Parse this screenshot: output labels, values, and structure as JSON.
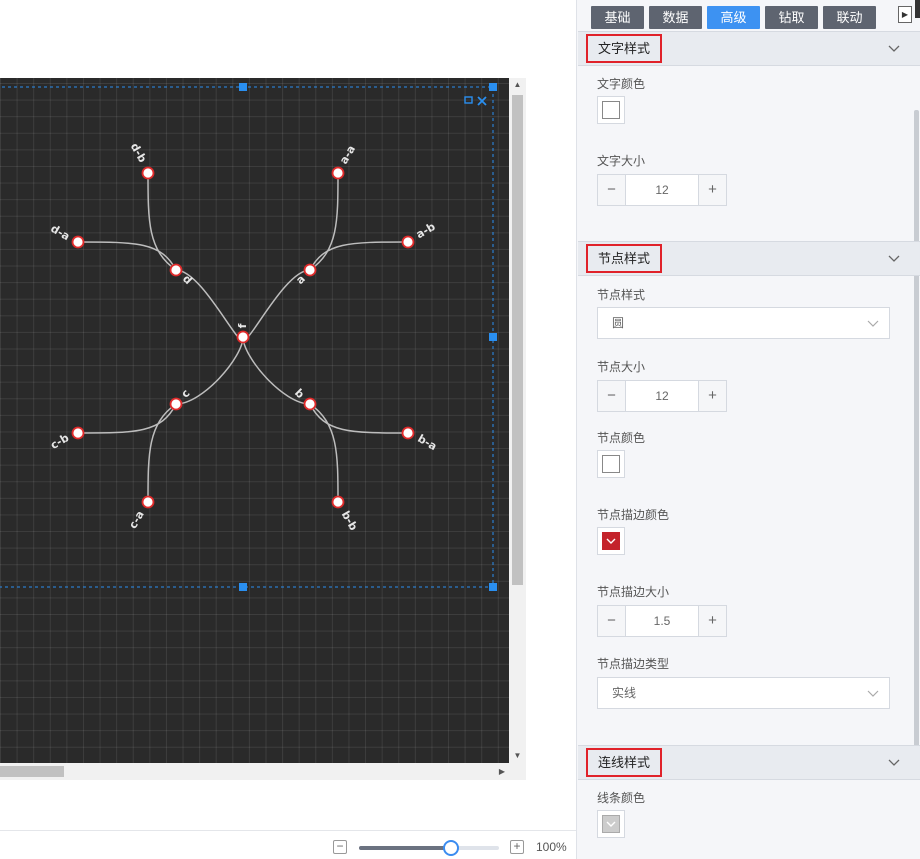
{
  "tabs": [
    {
      "label": "基础",
      "active": false
    },
    {
      "label": "数据",
      "active": false
    },
    {
      "label": "高级",
      "active": true
    },
    {
      "label": "钻取",
      "active": false
    },
    {
      "label": "联动",
      "active": false
    }
  ],
  "panel_toggle_icon": "play-triangle-icon",
  "sections": {
    "text_style": {
      "title": "文字样式",
      "text_color_label": "文字颜色",
      "text_color": "#ffffff",
      "text_size_label": "文字大小",
      "text_size": "12"
    },
    "node_style": {
      "title": "节点样式",
      "shape_label": "节点样式",
      "shape_value": "圆",
      "size_label": "节点大小",
      "size_value": "12",
      "color_label": "节点颜色",
      "color": "#ffffff",
      "stroke_color_label": "节点描边颜色",
      "stroke_color": "#c4232b",
      "stroke_size_label": "节点描边大小",
      "stroke_size": "1.5",
      "stroke_type_label": "节点描边类型",
      "stroke_type_value": "实线"
    },
    "line_style": {
      "title": "连线样式",
      "line_color_label": "线条颜色",
      "line_color": "#cccccc"
    }
  },
  "graph": {
    "nodes": [
      {
        "id": "f",
        "label": "f"
      },
      {
        "id": "a",
        "label": "a"
      },
      {
        "id": "b",
        "label": "b"
      },
      {
        "id": "c",
        "label": "c"
      },
      {
        "id": "d",
        "label": "d"
      },
      {
        "id": "a-a",
        "label": "a-a"
      },
      {
        "id": "a-b",
        "label": "a-b"
      },
      {
        "id": "b-a",
        "label": "b-a"
      },
      {
        "id": "b-b",
        "label": "b-b"
      },
      {
        "id": "c-a",
        "label": "c-a"
      },
      {
        "id": "c-b",
        "label": "c-b"
      },
      {
        "id": "d-a",
        "label": "d-a"
      },
      {
        "id": "d-b",
        "label": "d-b"
      }
    ],
    "edges": [
      [
        "f",
        "a"
      ],
      [
        "f",
        "b"
      ],
      [
        "f",
        "c"
      ],
      [
        "f",
        "d"
      ],
      [
        "a",
        "a-a"
      ],
      [
        "a",
        "a-b"
      ],
      [
        "b",
        "b-a"
      ],
      [
        "b",
        "b-b"
      ],
      [
        "c",
        "c-a"
      ],
      [
        "c",
        "c-b"
      ],
      [
        "d",
        "d-a"
      ],
      [
        "d",
        "d-b"
      ]
    ],
    "node_fill": "#ffffff",
    "node_stroke": "#e02a2a",
    "edge_color": "#bdbdbd",
    "label_color": "#e6e6e6",
    "selection_color": "#2a8ff0"
  },
  "zoom": {
    "percent_label": "100%",
    "level": 0.66
  }
}
